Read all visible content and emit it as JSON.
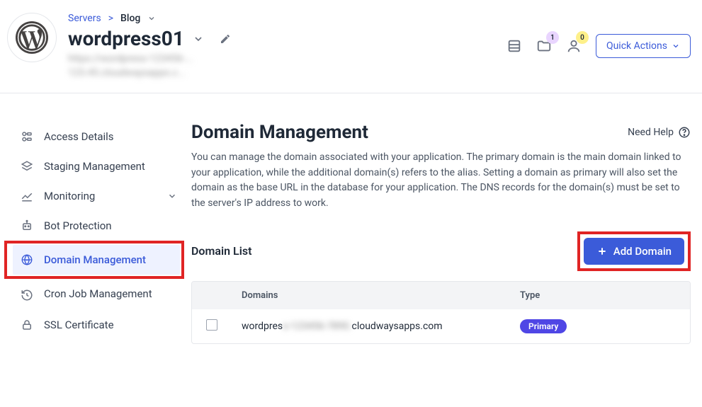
{
  "header": {
    "breadcrumb": {
      "servers": "Servers",
      "sep": ">",
      "current": "Blog"
    },
    "app_title": "wordpress01",
    "blurred_line1": "https://wordpress-123456-...",
    "blurred_line2": "123.45.cloudwaysapps.c...",
    "folder_badge": "1",
    "user_badge": "0",
    "quick_actions": "Quick Actions"
  },
  "sidebar": {
    "items": [
      {
        "label": "Access Details"
      },
      {
        "label": "Staging Management"
      },
      {
        "label": "Monitoring"
      },
      {
        "label": "Bot Protection"
      },
      {
        "label": "Domain Management"
      },
      {
        "label": "Cron Job Management"
      },
      {
        "label": "SSL Certificate"
      }
    ]
  },
  "main": {
    "title": "Domain Management",
    "need_help": "Need Help",
    "description": "You can manage the domain associated with your application. The primary domain is the main domain linked to your application, while the additional domain(s) refers to the alias. Setting a domain as primary will also set the domain as the base URL in the database for your application. The DNS records for the domain(s) must be set to the server's IP address to work.",
    "list_title": "Domain List",
    "add_domain": "Add Domain",
    "table": {
      "col_domains": "Domains",
      "col_type": "Type",
      "row1": {
        "domain_prefix": "wordpres",
        "domain_blur": "s-123456-7890.",
        "domain_suffix": "cloudwaysapps.com",
        "type_badge": "Primary"
      }
    }
  }
}
